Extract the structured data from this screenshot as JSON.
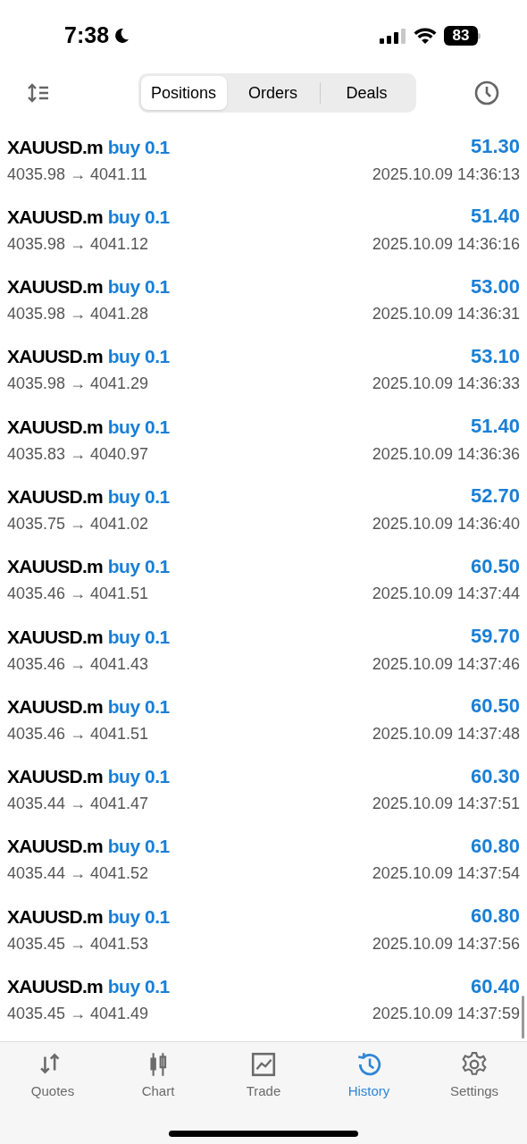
{
  "status_bar": {
    "time": "7:38",
    "battery": "83"
  },
  "tabs": [
    {
      "label": "Positions",
      "selected": true
    },
    {
      "label": "Orders",
      "selected": false
    },
    {
      "label": "Deals",
      "selected": false
    }
  ],
  "deals": [
    {
      "symbol": "XAUUSD.m",
      "type": "buy 0.1",
      "prices": "4035.98 → 4041.11",
      "profit": "51.30",
      "time": "2025.10.09 14:36:13"
    },
    {
      "symbol": "XAUUSD.m",
      "type": "buy 0.1",
      "prices": "4035.98 → 4041.12",
      "profit": "51.40",
      "time": "2025.10.09 14:36:16"
    },
    {
      "symbol": "XAUUSD.m",
      "type": "buy 0.1",
      "prices": "4035.98 → 4041.28",
      "profit": "53.00",
      "time": "2025.10.09 14:36:31"
    },
    {
      "symbol": "XAUUSD.m",
      "type": "buy 0.1",
      "prices": "4035.98 → 4041.29",
      "profit": "53.10",
      "time": "2025.10.09 14:36:33"
    },
    {
      "symbol": "XAUUSD.m",
      "type": "buy 0.1",
      "prices": "4035.83 → 4040.97",
      "profit": "51.40",
      "time": "2025.10.09 14:36:36"
    },
    {
      "symbol": "XAUUSD.m",
      "type": "buy 0.1",
      "prices": "4035.75 → 4041.02",
      "profit": "52.70",
      "time": "2025.10.09 14:36:40"
    },
    {
      "symbol": "XAUUSD.m",
      "type": "buy 0.1",
      "prices": "4035.46 → 4041.51",
      "profit": "60.50",
      "time": "2025.10.09 14:37:44"
    },
    {
      "symbol": "XAUUSD.m",
      "type": "buy 0.1",
      "prices": "4035.46 → 4041.43",
      "profit": "59.70",
      "time": "2025.10.09 14:37:46"
    },
    {
      "symbol": "XAUUSD.m",
      "type": "buy 0.1",
      "prices": "4035.46 → 4041.51",
      "profit": "60.50",
      "time": "2025.10.09 14:37:48"
    },
    {
      "symbol": "XAUUSD.m",
      "type": "buy 0.1",
      "prices": "4035.44 → 4041.47",
      "profit": "60.30",
      "time": "2025.10.09 14:37:51"
    },
    {
      "symbol": "XAUUSD.m",
      "type": "buy 0.1",
      "prices": "4035.44 → 4041.52",
      "profit": "60.80",
      "time": "2025.10.09 14:37:54"
    },
    {
      "symbol": "XAUUSD.m",
      "type": "buy 0.1",
      "prices": "4035.45 → 4041.53",
      "profit": "60.80",
      "time": "2025.10.09 14:37:56"
    },
    {
      "symbol": "XAUUSD.m",
      "type": "buy 0.1",
      "prices": "4035.45 → 4041.49",
      "profit": "60.40",
      "time": "2025.10.09 14:37:59"
    }
  ],
  "bottom_nav": [
    {
      "label": "Quotes",
      "kind": "quotes",
      "selected": false
    },
    {
      "label": "Chart",
      "kind": "chart",
      "selected": false
    },
    {
      "label": "Trade",
      "kind": "trade",
      "selected": false
    },
    {
      "label": "History",
      "kind": "history",
      "selected": true
    },
    {
      "label": "Settings",
      "kind": "settings",
      "selected": false
    }
  ]
}
